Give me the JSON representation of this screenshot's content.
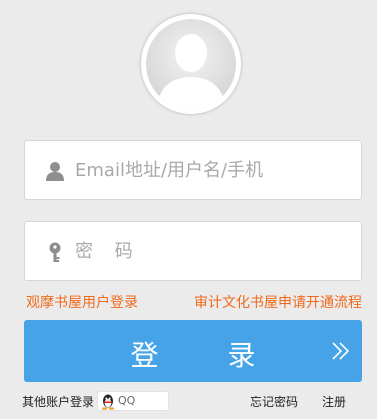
{
  "avatar": {
    "icon": "default-user-avatar-icon"
  },
  "username": {
    "placeholder": "Email地址/用户名/手机",
    "value": "",
    "icon": "user-icon"
  },
  "password": {
    "placeholder": "密 码",
    "value": "",
    "icon": "key-icon"
  },
  "links": {
    "user_login": "观摩书屋用户登录",
    "apply": "审计文化书屋申请开通流程"
  },
  "login_button": {
    "label": "登 录",
    "icon": "double-chevron-right-icon"
  },
  "footer": {
    "other_accounts": "其他账户登录",
    "qq_label": "QQ",
    "forgot_password": "忘记密码",
    "register": "注册"
  },
  "colors": {
    "background": "#ebebeb",
    "accent_orange": "#f06a1a",
    "button_blue": "#46a3e8",
    "placeholder_gray": "#a9a9a9"
  }
}
